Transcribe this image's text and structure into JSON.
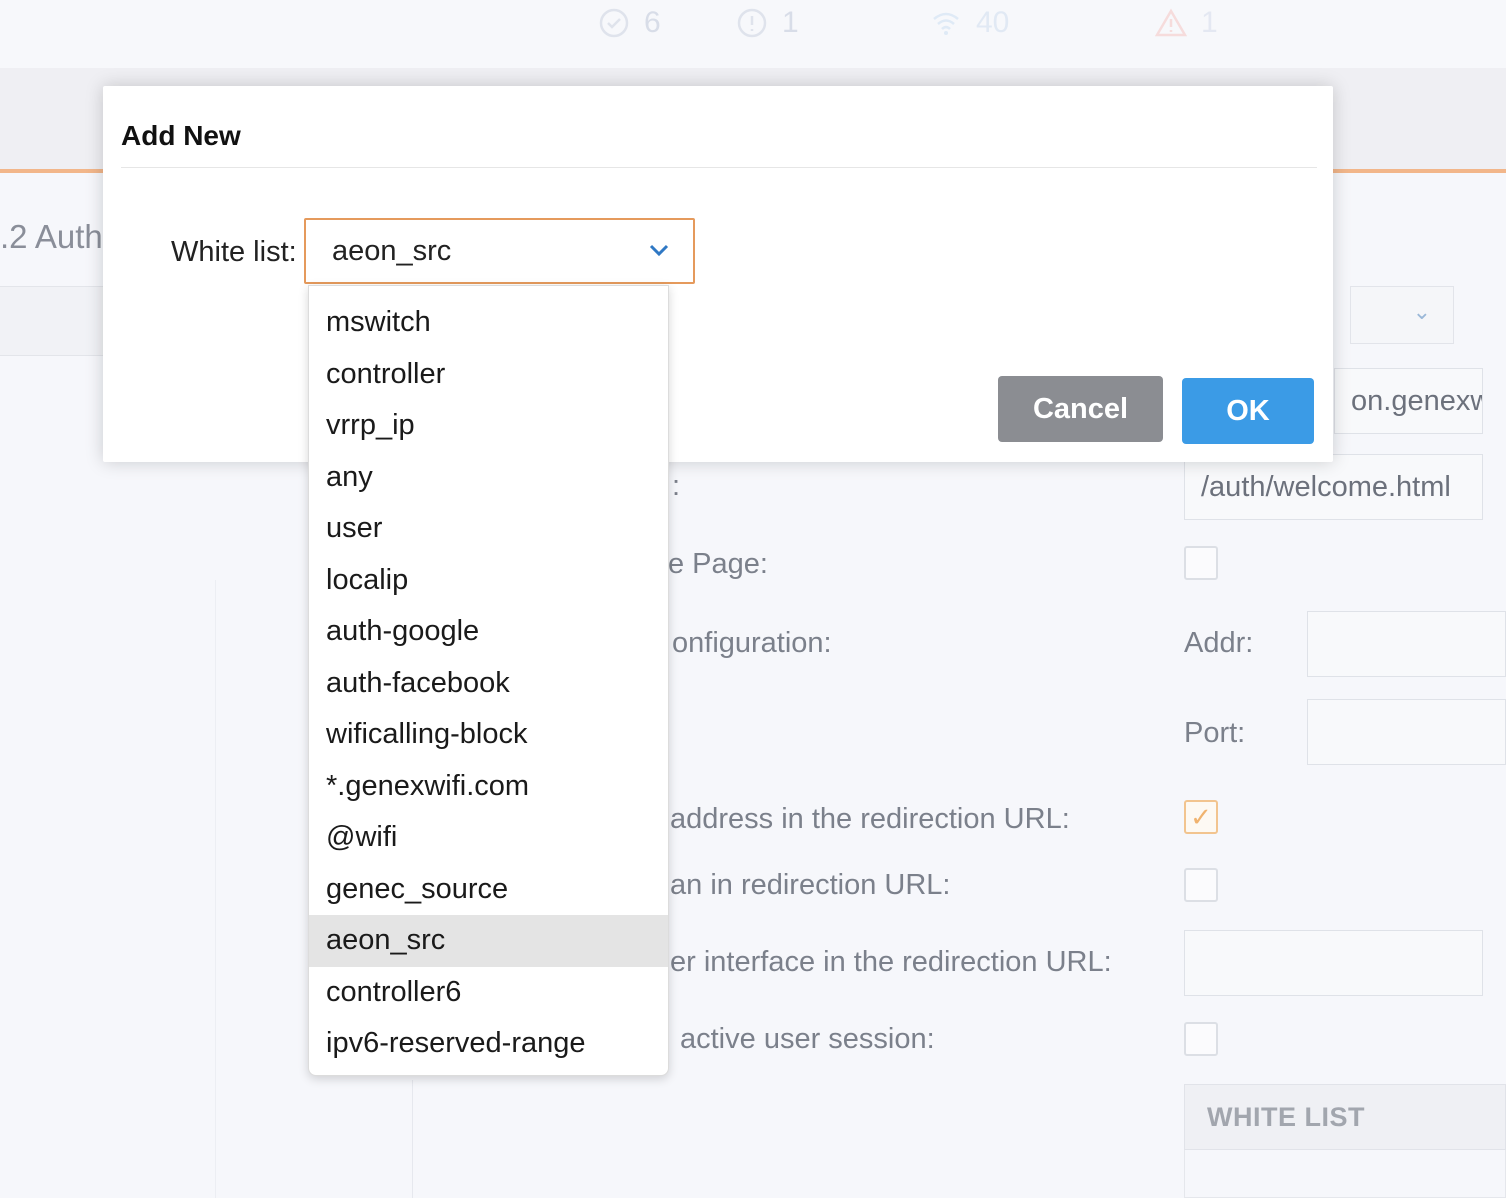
{
  "topbar": {
    "stats": [
      {
        "icon": "check-circle-icon",
        "value": "6"
      },
      {
        "icon": "info-circle-icon",
        "value": "1"
      },
      {
        "icon": "wifi-icon",
        "value": "40"
      },
      {
        "icon": "warning-triangle-icon",
        "value": "1"
      }
    ]
  },
  "background": {
    "left_panel_title": ".2 Auth",
    "url_input_value": "on.genexw",
    "welcome_input_value": "/auth/welcome.html",
    "labels": {
      "welcome_fragment": ":",
      "page_fragment": "e Page:",
      "configuration_fragment": "onfiguration:",
      "addr": "Addr:",
      "port": "Port:",
      "address_redirection": "address in the redirection URL:",
      "an_redirection": "an in redirection URL:",
      "interface_redirection": "er interface in the redirection URL:",
      "active_session": "active user session:"
    },
    "white_list_header": "WHITE LIST"
  },
  "modal": {
    "title": "Add New",
    "white_list_label": "White list:",
    "selected_value": "aeon_src",
    "cancel_label": "Cancel",
    "ok_label": "OK",
    "options": [
      "mswitch",
      "controller",
      "vrrp_ip",
      "any",
      "user",
      "localip",
      "auth-google",
      "auth-facebook",
      "wificalling-block",
      "*.genexwifi.com",
      "@wifi",
      "genec_source",
      "aeon_src",
      "controller6",
      "ipv6-reserved-range"
    ]
  },
  "colors": {
    "accent_orange": "#e59a5c",
    "ok_blue": "#3b9be6",
    "cancel_gray": "#8b8d92",
    "selected_option_bg": "#e4e4e4"
  }
}
